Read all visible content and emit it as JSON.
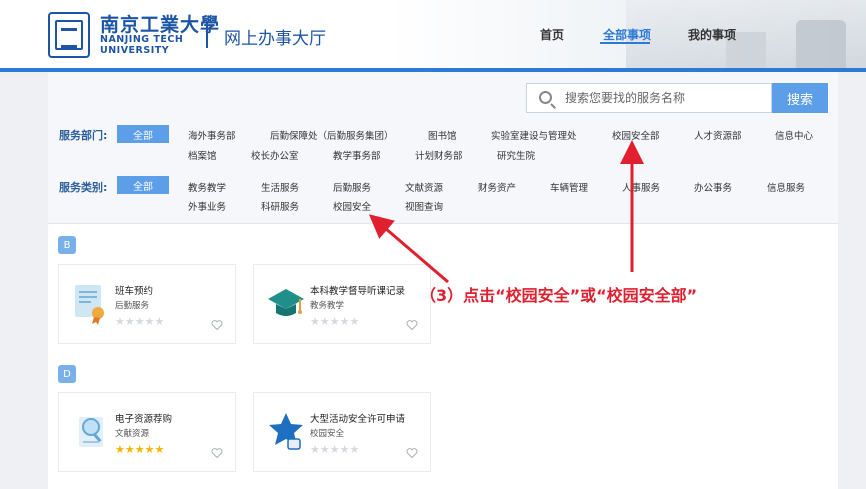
{
  "header": {
    "school_cn": "南京工業大學",
    "school_en_line1": "NANJING TECH",
    "school_en_line2": "UNIVERSITY",
    "portal_title": "网上办事大厅",
    "nav": [
      {
        "label": "首页",
        "active": false
      },
      {
        "label": "全部事项",
        "active": true
      },
      {
        "label": "我的事项",
        "active": false
      }
    ]
  },
  "search": {
    "placeholder": "搜索您要找的服务名称",
    "button_label": "搜索"
  },
  "filters": {
    "department": {
      "label": "服务部门:",
      "all_label": "全部",
      "options": [
        "海外事务部",
        "后勤保障处（后勤服务集团）",
        "图书馆",
        "实验室建设与管理处",
        "校园安全部",
        "人才资源部",
        "信息中心",
        "档案馆",
        "校长办公室",
        "教学事务部",
        "计划财务部",
        "研究生院"
      ]
    },
    "category": {
      "label": "服务类别:",
      "all_label": "全部",
      "options": [
        "教务教学",
        "生活服务",
        "后勤服务",
        "文献资源",
        "财务资产",
        "车辆管理",
        "人事服务",
        "办公事务",
        "信息服务",
        "外事业务",
        "科研服务",
        "校园安全",
        "视图查询"
      ]
    }
  },
  "sections": [
    {
      "letter": "B",
      "cards": [
        {
          "title": "班车预约",
          "category": "后勤服务",
          "rating": 0,
          "icon": "certificate-icon"
        },
        {
          "title": "本科教学督导听课记录",
          "category": "教务教学",
          "rating": 0,
          "icon": "graduation-cap-icon"
        }
      ]
    },
    {
      "letter": "D",
      "cards": [
        {
          "title": "电子资源荐购",
          "category": "文献资源",
          "rating": 5,
          "icon": "magnifier-document-icon"
        },
        {
          "title": "大型活动安全许可申请",
          "category": "校园安全",
          "rating": 0,
          "icon": "star-badge-icon"
        }
      ]
    }
  ],
  "annotation": {
    "text": "（3）点击“校园安全”或“校园安全部”",
    "color": "#e01f2f"
  },
  "colors": {
    "accent": "#2d7ad6",
    "button": "#5d9ee8",
    "star_on": "#f4b400",
    "star_off": "#d6d9de"
  }
}
